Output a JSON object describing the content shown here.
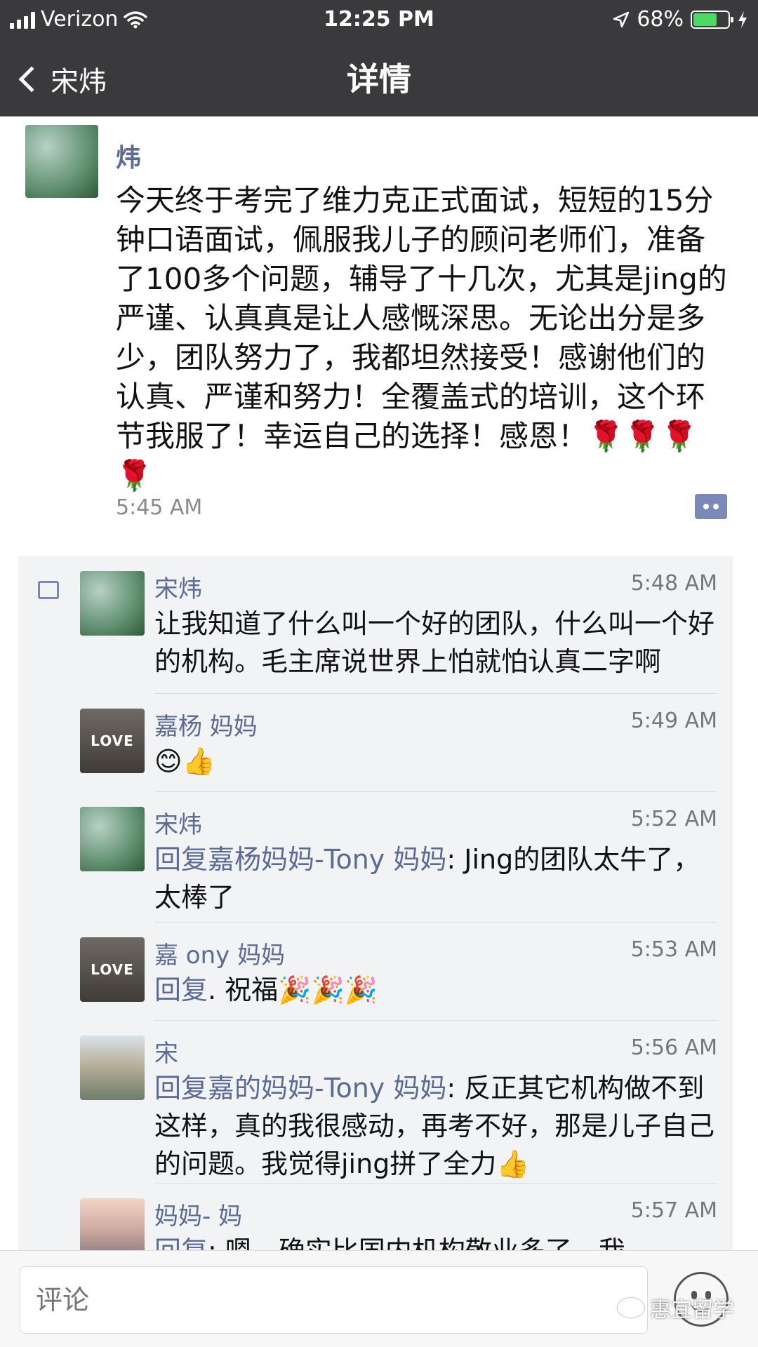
{
  "status_bar": {
    "carrier": "Verizon",
    "time": "12:25 PM",
    "battery": "68%",
    "battery_level": 0.68,
    "signal_icon": "signal-bars-icon",
    "wifi_icon": "wifi-icon",
    "location_icon": "location-arrow-icon",
    "charging_icon": "charging-bolt-icon"
  },
  "nav": {
    "back_label": "宋炜",
    "title": "详情"
  },
  "post": {
    "author": "炜",
    "text": "今天终于考完了维力克正式面试，短短的15分钟口语面试，佩服我儿子的顾问老师们，准备了100多个问题，辅导了十几次，尤其是jing的严谨、认真真是让人感慨深思。无论出分是多少，团队努力了，我都坦然接受！感谢他们的认真、严谨和努力！全覆盖式的培训，这个环节我服了！幸运自己的选择！感恩！🌹🌹🌹🌹",
    "time": "5:45 AM"
  },
  "comments": [
    {
      "name": "宋炜",
      "time": "5:48 AM",
      "reply_to": "",
      "text": "让我知道了什么叫一个好的团队，什么叫一个好的机构。毛主席说世界上怕就怕认真二字啊",
      "avatar": "green"
    },
    {
      "name": "嘉杨 妈妈",
      "time": "5:49 AM",
      "reply_to": "",
      "text": "😊👍",
      "avatar": "love"
    },
    {
      "name": "宋炜",
      "time": "5:52 AM",
      "reply_to": "回复嘉杨妈妈-Tony 妈妈",
      "text": ": Jing的团队太牛了，太棒了",
      "avatar": "green"
    },
    {
      "name": "嘉 ony 妈妈",
      "time": "5:53 AM",
      "reply_to": "回复",
      "text": ". 祝福🎉🎉🎉",
      "avatar": "love"
    },
    {
      "name": "宋",
      "time": "5:56 AM",
      "reply_to": "回复嘉的妈妈-Tony 妈妈",
      "text": ": 反正其它机构做不到这样，真的我很感动，再考不好，那是儿子自己的问题。我觉得jing拼了全力👍",
      "avatar": "building"
    },
    {
      "name": "妈妈- 妈",
      "time": "5:57 AM",
      "reply_to": "回复",
      "text": ": 嗯，确实比国内机构敬业多了，我",
      "avatar": "sunset"
    }
  ],
  "input": {
    "placeholder": "评论"
  },
  "watermark": {
    "text": "惠宜留学"
  },
  "colors": {
    "nav_bg": "#3a3a3c",
    "name_blue": "#5b6b95",
    "comment_bg": "#f2f3f5",
    "battery_green": "#4cd964"
  }
}
